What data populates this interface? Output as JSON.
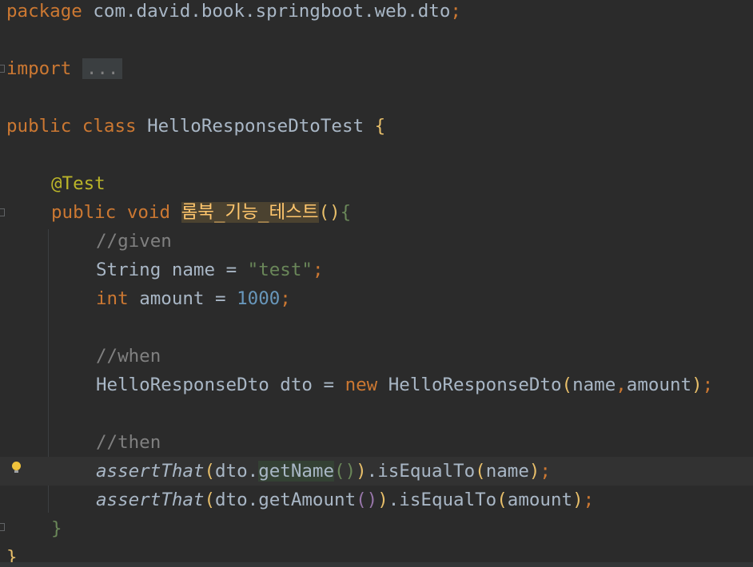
{
  "editor": {
    "lines": {
      "package": {
        "kw": "package",
        "path": "com.david.book.springboot.web.dto",
        "semi": ";"
      },
      "import": {
        "kw": "import",
        "folded": "..."
      },
      "class_decl": {
        "kw_public": "public",
        "kw_class": "class",
        "name": "HelloResponseDtoTest",
        "brace": "{"
      },
      "annotation": {
        "text": "@Test"
      },
      "method_decl": {
        "kw_public": "public",
        "kw_void": "void",
        "name": "롬북_기능_테스트",
        "parens": "()",
        "brace": "{"
      },
      "comment_given": {
        "text": "//given"
      },
      "string_decl": {
        "type": "String",
        "var": "name",
        "op": "=",
        "value": "\"test\"",
        "semi": ";"
      },
      "int_decl": {
        "type": "int",
        "var": "amount",
        "op": "=",
        "value": "1000",
        "semi": ";"
      },
      "comment_when": {
        "text": "//when"
      },
      "new_decl": {
        "type": "HelloResponseDto",
        "var": "dto",
        "op": "=",
        "kw_new": "new",
        "ctor": "HelloResponseDto",
        "open": "(",
        "arg1": "name",
        "comma": ",",
        "arg2": "amount",
        "close": ")",
        "semi": ";"
      },
      "comment_then": {
        "text": "//then"
      },
      "assert1": {
        "fn": "assertThat",
        "open": "(",
        "obj": "dto.",
        "method": "getName",
        "parens": "()",
        "close": ")",
        "chain": ".isEqualTo",
        "open2": "(",
        "arg": "name",
        "close2": ")",
        "semi": ";"
      },
      "assert2": {
        "fn": "assertThat",
        "open": "(",
        "obj": "dto.",
        "method": "getAmount",
        "parens": "()",
        "close": ")",
        "chain": ".isEqualTo",
        "open2": "(",
        "arg": "amount",
        "close2": ")",
        "semi": ";"
      },
      "method_close": {
        "brace": "}"
      },
      "class_close": {
        "brace": "}"
      }
    }
  }
}
